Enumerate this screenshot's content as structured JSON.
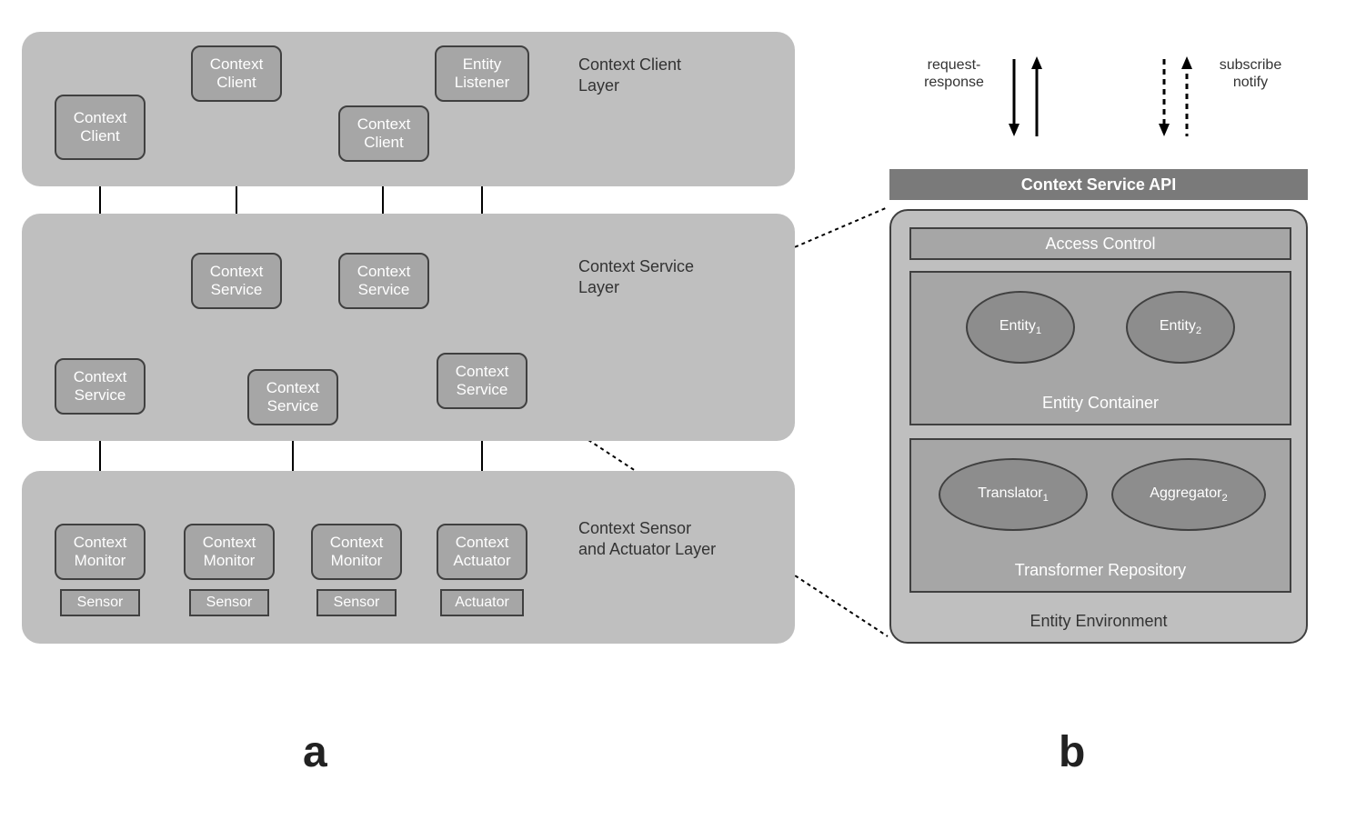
{
  "panel_a": {
    "layers": {
      "client": "Context Client\nLayer",
      "service": "Context Service\nLayer",
      "sensor": "Context Sensor\nand Actuator Layer"
    },
    "nodes": {
      "cc1": "Context\nClient",
      "cc2": "Context\nClient",
      "cc3": "Context\nClient",
      "el": "Entity\nListener",
      "cs1": "Context\nService",
      "cs2": "Context\nService",
      "cs3": "Context\nService",
      "cs4": "Context\nService",
      "cs5": "Context\nService",
      "cm1": "Context\nMonitor",
      "cm2": "Context\nMonitor",
      "cm3": "Context\nMonitor",
      "ca": "Context\nActuator",
      "s1": "Sensor",
      "s2": "Sensor",
      "s3": "Sensor",
      "act": "Actuator"
    },
    "label": "a"
  },
  "panel_b": {
    "legend": {
      "rr": "request-\nresponse",
      "sn": "subscribe\nnotify"
    },
    "api_bar": "Context Service API",
    "env_label": "Entity Environment",
    "access_control": "Access Control",
    "entity_container": "Entity Container",
    "entity1": "Entity",
    "entity1_sub": "1",
    "entity2": "Entity",
    "entity2_sub": "2",
    "transformer_repo": "Transformer Repository",
    "translator": "Translator",
    "translator_sub": "1",
    "aggregator": "Aggregator",
    "aggregator_sub": "2",
    "label": "b"
  }
}
